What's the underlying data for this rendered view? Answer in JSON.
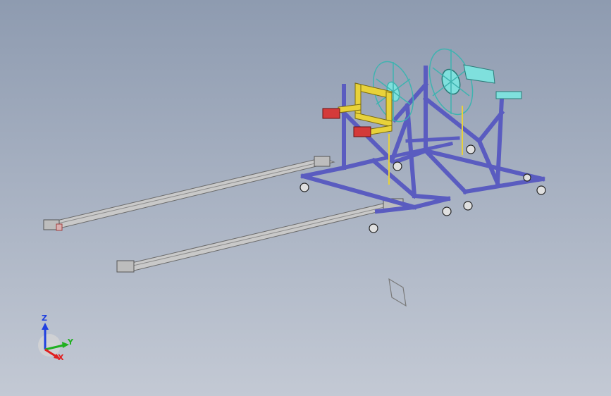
{
  "colors": {
    "background_top": "#8e9bb0",
    "background_bottom": "#c3c9d4",
    "frame": "#5a5cc0",
    "frame_edge": "#2c2c7a",
    "clamp_yellow": "#e8d23a",
    "clamp_red": "#d43a3a",
    "spool_cyan": "#5fd3d0",
    "rail_gray": "#c9c9c9",
    "rail_edge": "#6a6a6a",
    "axis_x": "#e02020",
    "axis_y": "#20b020",
    "axis_z": "#2040e0"
  },
  "icons": {
    "view_triad": "xyz-axis-triad-icon",
    "plane_marker": "sketch-plane-icon"
  },
  "triad": {
    "z_label": "Z",
    "y_label": "Y",
    "x_label": "X"
  }
}
